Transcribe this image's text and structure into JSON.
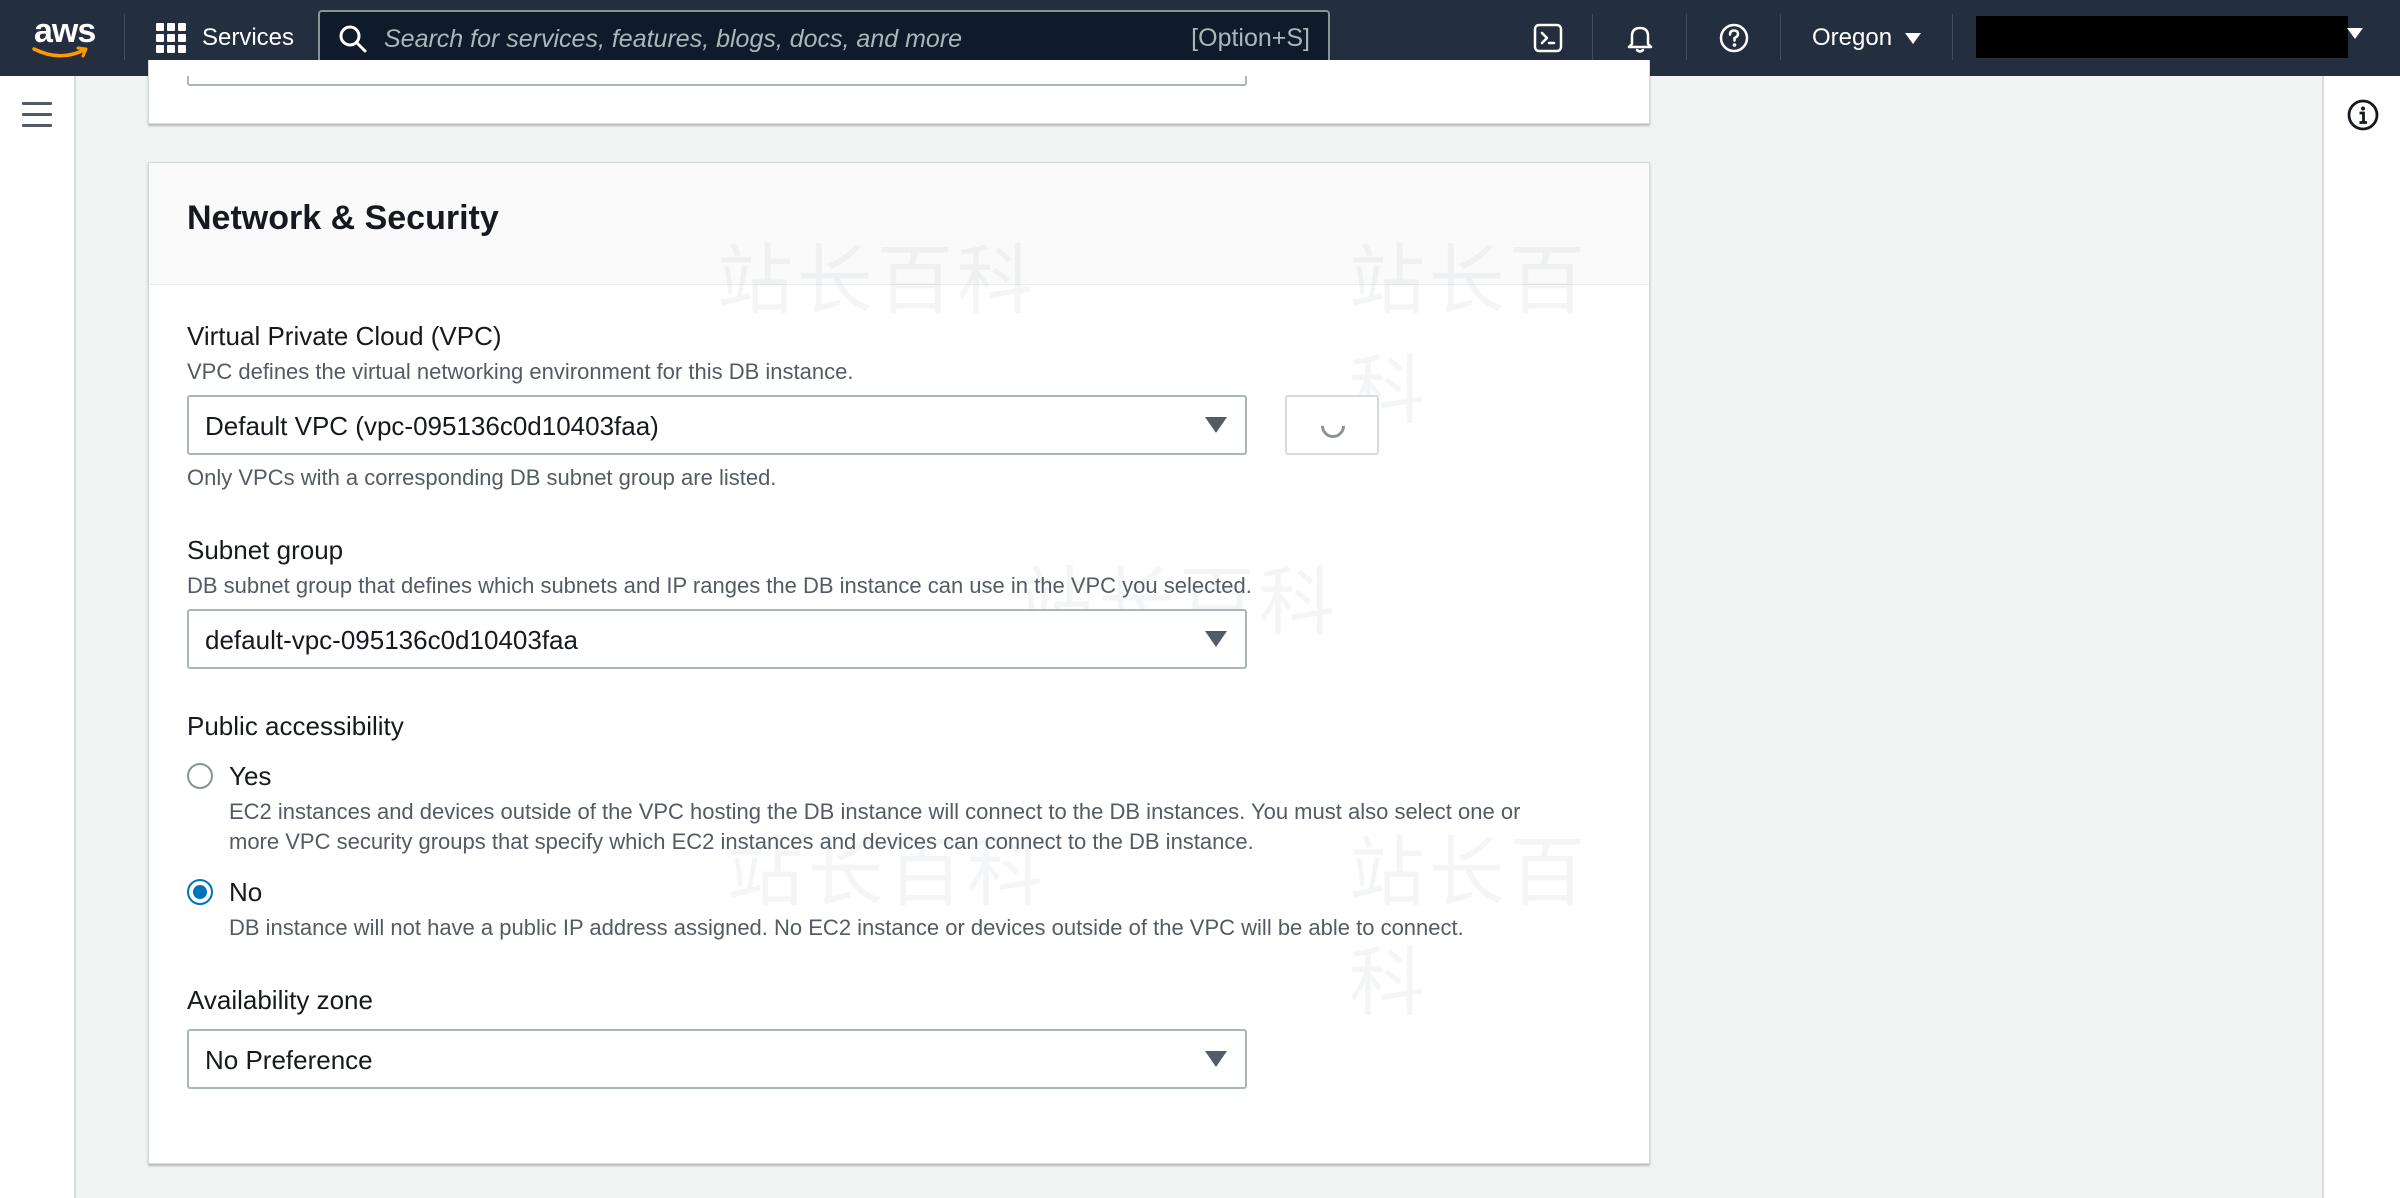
{
  "topnav": {
    "logo_text": "aws",
    "services_label": "Services",
    "search_placeholder": "Search for services, features, blogs, docs, and more",
    "search_shortcut": "[Option+S]",
    "region": "Oregon",
    "icons": [
      "cloudshell-icon",
      "bell-icon",
      "help-icon"
    ]
  },
  "colors": {
    "nav_bg": "#232f3e",
    "accent_blue": "#0073bb",
    "panel_bg": "#ffffff",
    "page_bg": "#f2f3f3"
  },
  "section": {
    "title": "Network & Security"
  },
  "vpc": {
    "label": "Virtual Private Cloud (VPC)",
    "description": "VPC defines the virtual networking environment for this DB instance.",
    "value": "Default VPC (vpc-095136c0d10403faa)",
    "hint": "Only VPCs with a corresponding DB subnet group are listed."
  },
  "subnet": {
    "label": "Subnet group",
    "description": "DB subnet group that defines which subnets and IP ranges the DB instance can use in the VPC you selected.",
    "value": "default-vpc-095136c0d10403faa"
  },
  "public_access": {
    "label": "Public accessibility",
    "options": [
      {
        "label": "Yes",
        "description": "EC2 instances and devices outside of the VPC hosting the DB instance will connect to the DB instances. You must also select one or more VPC security groups that specify which EC2 instances and devices can connect to the DB instance.",
        "selected": false
      },
      {
        "label": "No",
        "description": "DB instance will not have a public IP address assigned. No EC2 instance or devices outside of the VPC will be able to connect.",
        "selected": true
      }
    ]
  },
  "availability_zone": {
    "label": "Availability zone",
    "value": "No Preference"
  },
  "watermark": "站长百科"
}
